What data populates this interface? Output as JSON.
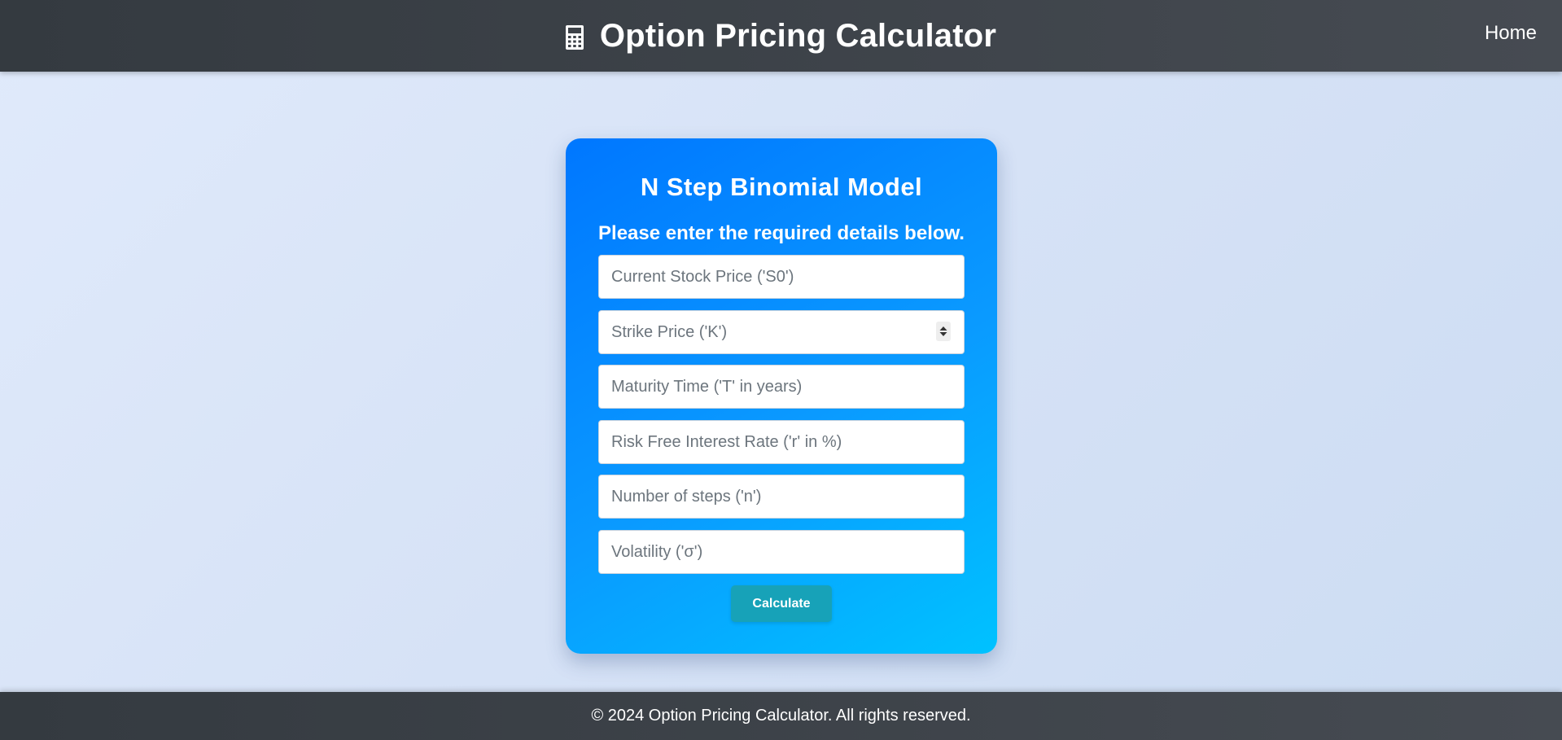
{
  "header": {
    "title": "Option Pricing Calculator",
    "icon": "calculator-icon",
    "nav_home": "Home"
  },
  "card": {
    "title": "N Step Binomial Model",
    "subtitle": "Please enter the required details below.",
    "fields": [
      {
        "placeholder": "Current Stock Price ('S0')",
        "value": ""
      },
      {
        "placeholder": "Strike Price ('K')",
        "value": ""
      },
      {
        "placeholder": "Maturity Time ('T' in years)",
        "value": ""
      },
      {
        "placeholder": "Risk Free Interest Rate ('r' in %)",
        "value": ""
      },
      {
        "placeholder": "Number of steps ('n')",
        "value": ""
      },
      {
        "placeholder": "Volatility ('σ')",
        "value": ""
      }
    ],
    "calculate_label": "Calculate"
  },
  "footer": {
    "text": "© 2024 Option Pricing Calculator. All rights reserved."
  },
  "colors": {
    "header_bg": "#343a40",
    "card_gradient_start": "#0077ff",
    "card_gradient_end": "#00c2ff",
    "button_bg": "#17a2b8",
    "page_bg": "#dbe5f7"
  }
}
